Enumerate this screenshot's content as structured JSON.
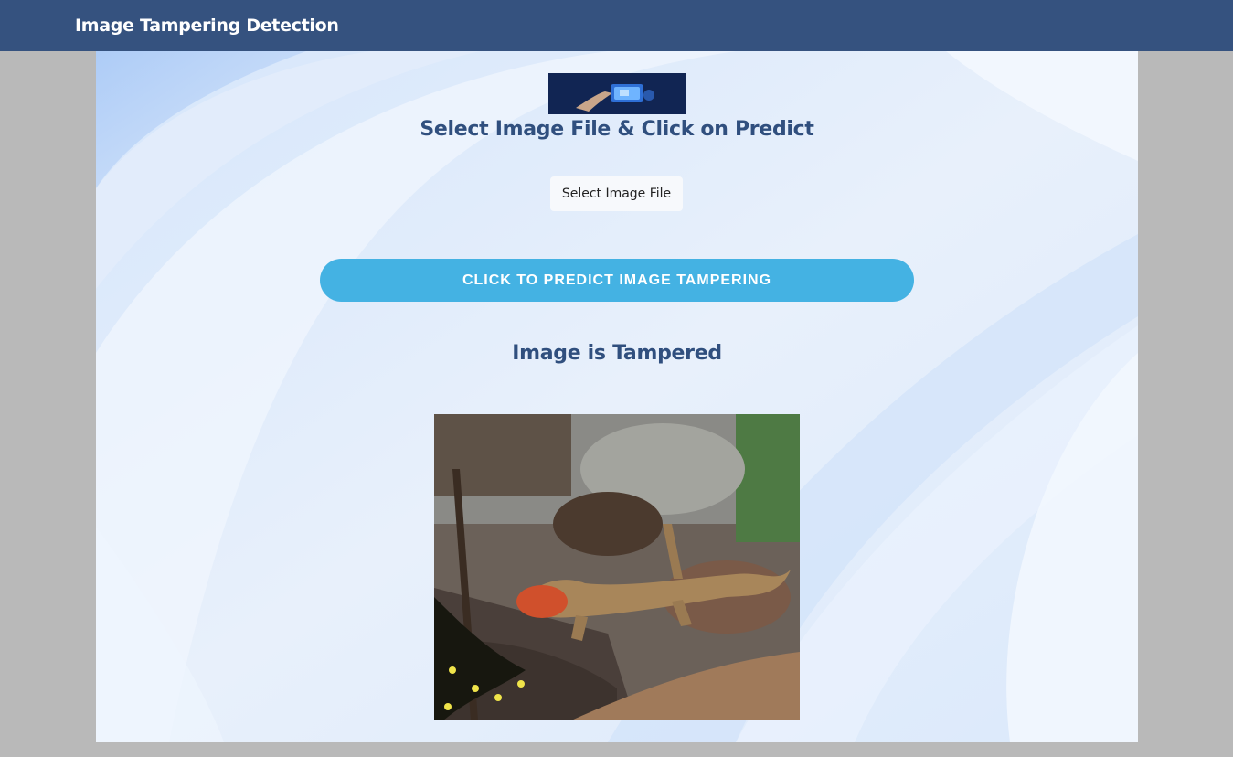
{
  "navbar": {
    "brand": "Image Tampering Detection",
    "background_color": "#35527f"
  },
  "main": {
    "banner_image": "hand-holding-phone-banner",
    "heading": "Select Image File & Click on Predict",
    "file_button_label": "Select Image File",
    "predict_button_label": "CLICK TO PREDICT IMAGE TAMPERING",
    "result_text": "Image is Tampered",
    "result_image": "lizard-on-log-photo",
    "heading_color": "#304f7e",
    "predict_button_color": "#44b2e3"
  }
}
